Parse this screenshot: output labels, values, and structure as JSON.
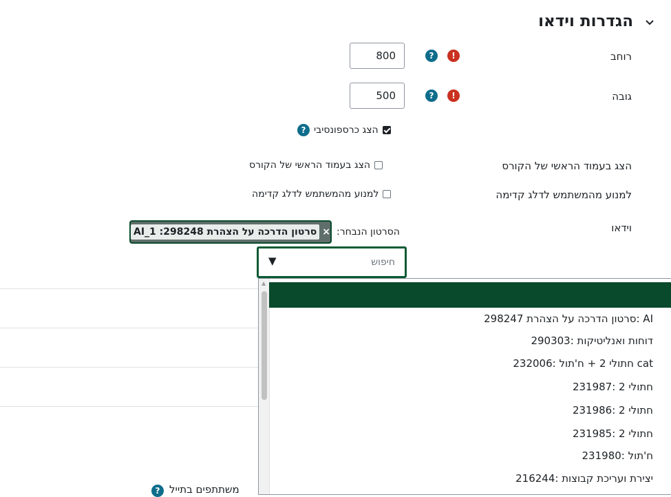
{
  "section": {
    "title": "הגדרות וידאו"
  },
  "width": {
    "label": "רוחב",
    "value": "800"
  },
  "height": {
    "label": "גובה",
    "value": "500"
  },
  "responsive": {
    "label": "הצג כרספונסיבי",
    "checked": true
  },
  "show_course_page": {
    "row_label": "הצג בעמוד הראשי של הקורס",
    "checkbox_label": "הצג בעמוד הראשי של הקורס",
    "checked": false
  },
  "prevent_skip": {
    "row_label": "למנוע מהמשתמש לדלג קדימה",
    "checkbox_label": "למנוע מהמשתמש לדלג קדימה",
    "checked": false
  },
  "video": {
    "label": "וידאו",
    "selected_label": "הסרטון הנבחר:",
    "selected_chip": "סרטון הדרכה על הצהרת 298248: AI_1",
    "chip_remove": "×",
    "search_placeholder": "חיפוש",
    "dropdown_arrow": "▼",
    "options": [
      "סרטון הדרכה על הצהרת 298247: AI",
      "דוחות ואנליטיקות :290303",
      "232006: חתולי 2 + ח'תול cat",
      "חתולי 2 :231987",
      "חתולי 2 :231986",
      "חתולי 2 :231985",
      "ח'תול :231980",
      "יצירת ועריכת קבוצות :216244"
    ]
  },
  "bottom": {
    "text": "משתתפים בתייל"
  },
  "colors": {
    "accent": "#0a4a2c",
    "help": "#0f6d8c",
    "required": "#ca3120"
  },
  "icons": {
    "help": "?",
    "required": "!"
  }
}
